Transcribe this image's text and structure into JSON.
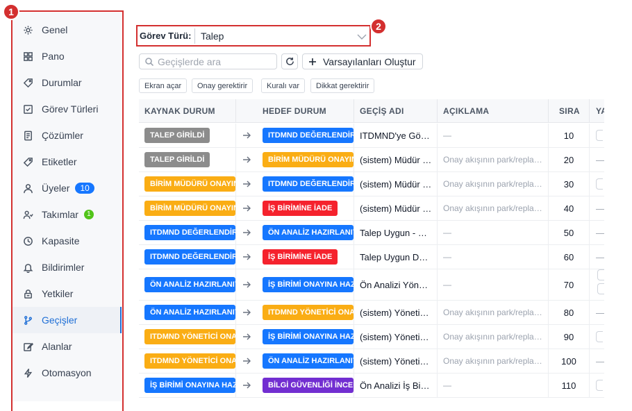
{
  "sidebar": {
    "items": [
      {
        "label": "Genel",
        "icon": "gear-icon"
      },
      {
        "label": "Pano",
        "icon": "grid-icon"
      },
      {
        "label": "Durumlar",
        "icon": "tag-icon"
      },
      {
        "label": "Görev Türleri",
        "icon": "checkbox-icon"
      },
      {
        "label": "Çözümler",
        "icon": "document-icon"
      },
      {
        "label": "Etiketler",
        "icon": "label-icon"
      },
      {
        "label": "Üyeler",
        "icon": "user-icon",
        "badge": "10"
      },
      {
        "label": "Takımlar",
        "icon": "users-icon",
        "badge": "1"
      },
      {
        "label": "Kapasite",
        "icon": "clock-icon"
      },
      {
        "label": "Bildirimler",
        "icon": "bell-icon"
      },
      {
        "label": "Yetkiler",
        "icon": "lock-icon"
      },
      {
        "label": "Geçişler",
        "icon": "branch-icon",
        "active": true
      },
      {
        "label": "Alanlar",
        "icon": "edit-icon"
      },
      {
        "label": "Otomasyon",
        "icon": "bolt-icon"
      }
    ]
  },
  "annotations": {
    "one": "1",
    "two": "2"
  },
  "filter": {
    "label": "Görev Türü:",
    "value": "Talep"
  },
  "search": {
    "placeholder": "Geçişlerde ara"
  },
  "toolbar": {
    "defaults_label": "Varsayılanları Oluştur"
  },
  "chips": [
    "Ekran açar",
    "Onay gerektirir",
    "Kuralı var",
    "Dikkat gerektirir"
  ],
  "table": {
    "headers": [
      "KAYNAK DURUM",
      "HEDEF DURUM",
      "GEÇİŞ ADI",
      "AÇIKLAMA",
      "SIRA",
      "YA"
    ],
    "rows": [
      {
        "src": "TALEP GİRİLDİ",
        "srcColor": "#8c8c8c",
        "dst": "ITDMND DEĞERLENDİRME",
        "dstColor": "#1677ff",
        "name": "ITDMND'ye Gönder",
        "desc": "—",
        "order": "10",
        "ya": "chip"
      },
      {
        "src": "TALEP GİRİLDİ",
        "srcColor": "#8c8c8c",
        "dst": "BİRİM MÜDÜRÜ ONAYINDA",
        "dstColor": "#faad14",
        "name": "(sistem) Müdür Onayına",
        "desc": "Onay akışının park/replay adımı",
        "order": "20",
        "ya": "—"
      },
      {
        "src": "BİRİM MÜDÜRÜ ONAYINDA",
        "srcColor": "#faad14",
        "dst": "ITDMND DEĞERLENDİRME",
        "dstColor": "#1677ff",
        "name": "(sistem) Müdür Onayladı",
        "desc": "Onay akışının park/replay adımı",
        "order": "30",
        "ya": "chip"
      },
      {
        "src": "BİRİM MÜDÜRÜ ONAYINDA",
        "srcColor": "#faad14",
        "dst": "İŞ BİRİMİNE İADE",
        "dstColor": "#f5222d",
        "name": "(sistem) Müdür Reddetti",
        "desc": "Onay akışının park/replay adımı",
        "order": "40",
        "ya": "—"
      },
      {
        "src": "ITDMND DEĞERLENDİRME",
        "srcColor": "#1677ff",
        "dst": "ÖN ANALİZ HAZIRLANIYOR",
        "dstColor": "#1677ff",
        "name": "Talep Uygun - Ön Analiz",
        "desc": "—",
        "order": "50",
        "ya": "—"
      },
      {
        "src": "ITDMND DEĞERLENDİRME",
        "srcColor": "#1677ff",
        "dst": "İŞ BİRİMİNE İADE",
        "dstColor": "#f5222d",
        "name": "Talep Uygun Değil",
        "desc": "—",
        "order": "60",
        "ya": "—"
      },
      {
        "src": "ÖN ANALİZ HAZIRLANIYOR",
        "srcColor": "#1677ff",
        "dst": "İŞ BİRİMİ ONAYINA HAZIR",
        "dstColor": "#1677ff",
        "name": "Ön Analizi Yönetici Onayına",
        "desc": "—",
        "order": "70",
        "ya": "chip2"
      },
      {
        "src": "ÖN ANALİZ HAZIRLANIYOR",
        "srcColor": "#1677ff",
        "dst": "ITDMND YÖNETİCİ ONAYINDA",
        "dstColor": "#faad14",
        "name": "(sistem) Yönetici Onayına",
        "desc": "Onay akışının park/replay adımı",
        "order": "80",
        "ya": "—"
      },
      {
        "src": "ITDMND YÖNETİCİ ONAYINDA",
        "srcColor": "#faad14",
        "dst": "İŞ BİRİMİ ONAYINA HAZIR",
        "dstColor": "#1677ff",
        "name": "(sistem) Yönetici Onayladı",
        "desc": "Onay akışının park/replay adımı",
        "order": "90",
        "ya": "chip"
      },
      {
        "src": "ITDMND YÖNETİCİ ONAYINDA",
        "srcColor": "#faad14",
        "dst": "ÖN ANALİZ HAZIRLANIYOR",
        "dstColor": "#1677ff",
        "name": "(sistem) Yönetici Reddetti",
        "desc": "Onay akışının park/replay adımı",
        "order": "100",
        "ya": "—"
      },
      {
        "src": "İŞ BİRİMİ ONAYINA HAZIR",
        "srcColor": "#1677ff",
        "dst": "BİLGİ GÜVENLİĞİ İNCELEMESİ",
        "dstColor": "#722ed1",
        "name": "Ön Analizi İş Birimine",
        "desc": "—",
        "order": "110",
        "ya": "chip"
      }
    ]
  }
}
